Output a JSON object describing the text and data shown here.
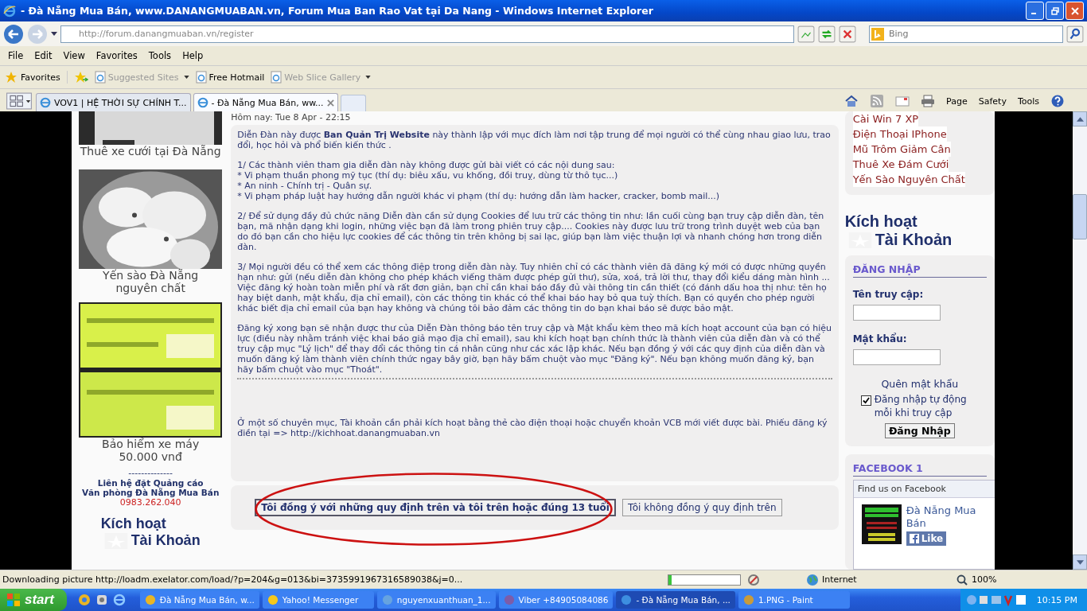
{
  "window": {
    "title": "- Đà Nẵng Mua Bán, www.DANANGMUABAN.vn, Forum Mua Ban Rao Vat tại Da Nang - Windows Internet Explorer"
  },
  "address_bar": {
    "url": "http://forum.danangmuaban.vn/register"
  },
  "search": {
    "placeholder": "Bing"
  },
  "menu": [
    "File",
    "Edit",
    "View",
    "Favorites",
    "Tools",
    "Help"
  ],
  "favorites_bar": {
    "label": "Favorites",
    "links": [
      {
        "label": "Suggested Sites",
        "dimmed": true,
        "dropdown": true
      },
      {
        "label": "Free Hotmail",
        "dimmed": false,
        "dropdown": false
      },
      {
        "label": "Web Slice Gallery",
        "dimmed": true,
        "dropdown": true
      }
    ]
  },
  "tabs": [
    {
      "label": "VOV1 | HỆ THỜI SỰ CHÍNH T...",
      "selected": false
    },
    {
      "label": "- Đà Nẵng Mua Bán, ww...",
      "selected": true
    }
  ],
  "command_bar": [
    "Page",
    "Safety",
    "Tools"
  ],
  "left_column": {
    "ads": [
      {
        "caption": "Thuê xe cưới tại Đà Nẵng",
        "kind": "small"
      },
      {
        "caption": "Yến sào Đà Nẵng nguyên chất",
        "kind": "large"
      },
      {
        "caption": "Bảo hiểm xe máy 50.000 vnđ",
        "kind": "large"
      }
    ],
    "separator": "--------------",
    "contact": [
      "Liên hệ đặt Quảng cáo",
      "Văn phòng Đà Nẵng Mua Bán"
    ],
    "phone": "0983.262.040",
    "activate": [
      "Kích hoạt",
      "Tài Khoản"
    ]
  },
  "main": {
    "date": "Hôm nay: Tue 8 Apr - 22:15",
    "paragraphs": [
      [
        "Diễn Đàn này được **Ban Quản Trị Website** này thành lập với mục đích làm nơi tập trung để mọi người có thể cùng nhau giao lưu, trao đổi, học hỏi và phổ biến kiến thức ."
      ],
      [
        "1/ Các thành viên tham gia diễn đàn này không được gửi bài viết có các nội dung sau:",
        "* Vi phạm thuần phong mỹ tục (thí dụ: biêu xấu, vu khống, đồi truỵ, dùng từ thô tục...)",
        "* An ninh - Chính trị - Quân sự.",
        "* Vi phạm pháp luật hay hướng dẫn người khác vi phạm (thí dụ: hướng dẫn làm hacker, cracker, bomb mail...)"
      ],
      [
        "2/ Để sử dụng đầy đủ chức năng Diễn đàn cần sử dụng Cookies để lưu trữ các thông tin như: lần cuối cùng bạn truy cập diễn đàn, tên bạn, mã nhận dạng khi login, những việc bạn đã làm trong phiên truy cập.... Cookies này được lưu trữ trong trình duyệt web của bạn do đó bạn cần cho hiệu lực cookies để các thông tin trên không bị sai lạc, giúp bạn làm việc thuận lợi và nhanh chóng hơn trong diễn đàn."
      ],
      [
        "3/ Mọi người đều có thể xem các thông điệp trong diễn đàn này. Tuy nhiên chỉ có các thành viên đã đăng ký mới có được những quyền hạn như: gửi (nếu diễn đàn không cho phép khách viếng thăm được phép gửi thư), sửa, xoá, trả lời thư, thay đổi kiểu dáng màn hình ... Việc đăng ký hoàn toàn miễn phí và rất đơn giản, bạn chỉ cần khai báo đầy đủ vài thông tin cần thiết (có đánh dấu hoa thị như: tên họ hay biệt danh, mật khẩu, địa chỉ email), còn các thông tin khác có thể khai báo hay bỏ qua tuỳ thích. Bạn có quyền cho phép người khác biết địa chỉ email của bạn hay không và chúng tôi bảo đảm các thông tin do bạn khai báo sẽ được bảo mật."
      ],
      [
        "Đăng ký xong bạn sẽ nhận được thư của Diễn Đàn thông báo tên truy cập và Mật khẩu kèm theo mã kích hoạt account của bạn có hiệu lực (điều này nhằm tránh việc khai báo giả mạo địa chỉ email), sau khi kích hoạt bạn chính thức là thành viên của diễn đàn và có thể truy cập mục \"Lý lịch\" để thay đổi các thông tin cá nhân cũng như các xác lập khác. Nếu bạn đồng ý với các quy định của diễn đàn và muốn đăng ký làm thành viên chính thức ngay bây giờ, bạn hãy bấm chuột vào mục \"Đăng ký\". Nếu bạn không muốn đăng ký, bạn hãy bấm chuột vào mục \"Thoát\"."
      ]
    ],
    "note": "Ở một số chuyên mục, Tài khoản cần phải kích hoạt bằng thẻ cào điện thoại hoặc chuyển khoản VCB mới viết được bài. Phiếu đăng ký điền tại  => http://kichhoat.danangmuaban.vn",
    "buttons": [
      {
        "label": "Tôi đồng ý với những quy định trên và tôi trên hoặc đúng 13 tuổi",
        "kind": "primary"
      },
      {
        "label": "Tôi không đồng ý quy định trên",
        "kind": "secondary"
      }
    ],
    "highlight": {
      "kind": "ellipse",
      "color": "#cc1111"
    }
  },
  "right_column": {
    "links": [
      "Cài Win 7 XP",
      "Điện Thoại IPhone",
      "Mũ Trôm Giảm Cân",
      "Thuê Xe Đám Cưới",
      "Yến Sào Nguyên Chất"
    ],
    "activate": [
      "Kích hoạt",
      "Tài Khoản"
    ],
    "login": {
      "title": "ĐĂNG NHẬP",
      "username_label": "Tên truy cập:",
      "password_label": "Mật khẩu:",
      "forgot": "Quên mật khẩu",
      "remember": {
        "label": "Đăng nhập tự động mỗi khi truy cập",
        "checked": true
      },
      "submit": "Đăng Nhập"
    },
    "facebook": {
      "title": "FACEBOOK 1",
      "header": "Find us on Facebook",
      "page_name": "Đà Nẵng Mua Bán",
      "like": "Like"
    }
  },
  "status_bar": {
    "text": "Downloading picture http://loadm.exelator.com/load/?p=204&g=013&bi=3735991967316589038&j=0...",
    "progress": {
      "level": 0.04
    },
    "zone": "Internet",
    "zoom": "100%"
  },
  "taskbar": {
    "start": "start",
    "items": [
      {
        "label": "Đà Nẵng Mua Bán, w...",
        "kind": "chrome",
        "selected": false
      },
      {
        "label": "Yahoo! Messenger",
        "kind": "yahoo",
        "selected": false
      },
      {
        "label": "nguyenxuanthuan_1...",
        "kind": "chat",
        "selected": false
      },
      {
        "label": "Viber +84905084086",
        "kind": "viber",
        "selected": false
      },
      {
        "label": "- Đà Nẵng Mua Bán, ...",
        "kind": "ie",
        "selected": true
      },
      {
        "label": "1.PNG - Paint",
        "kind": "paint",
        "selected": false
      }
    ],
    "clock": "10:15 PM"
  }
}
